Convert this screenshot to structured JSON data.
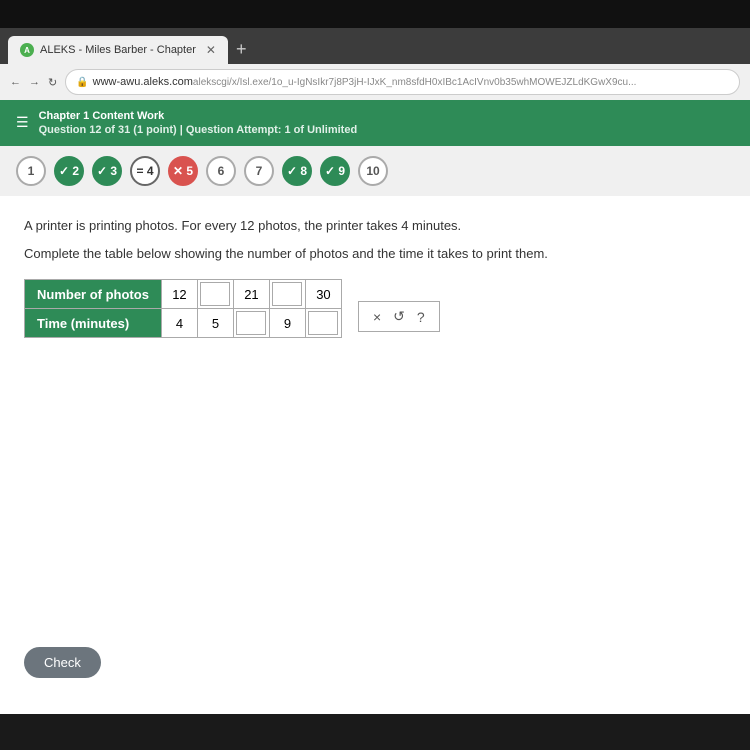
{
  "browser": {
    "tab_label": "ALEKS - Miles Barber - Chapter",
    "tab_new": "+",
    "address": "www-awu.aleks.com",
    "address_full": "alekscgi/x/Isl.exe/1o_u-IgNsIkr7j8P3jH-IJxK_nm8sfdH0xIBc1AcIVnv0b35whMOWEJZLdKGwX9cu..."
  },
  "header": {
    "chapter_title": "Chapter 1 Content Work",
    "question_info": "Question 12 of 31 (1 point)  |  Question Attempt: 1 of Unlimited"
  },
  "navigation": {
    "buttons": [
      {
        "label": "1",
        "state": "current"
      },
      {
        "label": "✓ 2",
        "state": "completed-green"
      },
      {
        "label": "✓ 3",
        "state": "completed-green"
      },
      {
        "label": "= 4",
        "state": "completed-equal"
      },
      {
        "label": "✕ 5",
        "state": "wrong-red"
      },
      {
        "label": "6",
        "state": "current"
      },
      {
        "label": "7",
        "state": "current"
      },
      {
        "label": "✓ 8",
        "state": "completed-green"
      },
      {
        "label": "✓ 9",
        "state": "completed-green"
      },
      {
        "label": "10",
        "state": "current"
      }
    ]
  },
  "question": {
    "text": "A printer is printing photos. For every 12 photos, the printer takes 4 minutes.",
    "instruction": "Complete the table below showing the number of photos and the time it takes to print them.",
    "table": {
      "row1_header": "Number of photos",
      "row2_header": "Time (minutes)",
      "row1_cells": [
        "12",
        "",
        "21",
        "",
        "30"
      ],
      "row2_cells": [
        "4",
        "5",
        "",
        "9",
        ""
      ]
    },
    "tools": {
      "x_label": "×",
      "undo_label": "↺",
      "help_label": "?"
    }
  },
  "footer": {
    "check_button": "Check"
  }
}
